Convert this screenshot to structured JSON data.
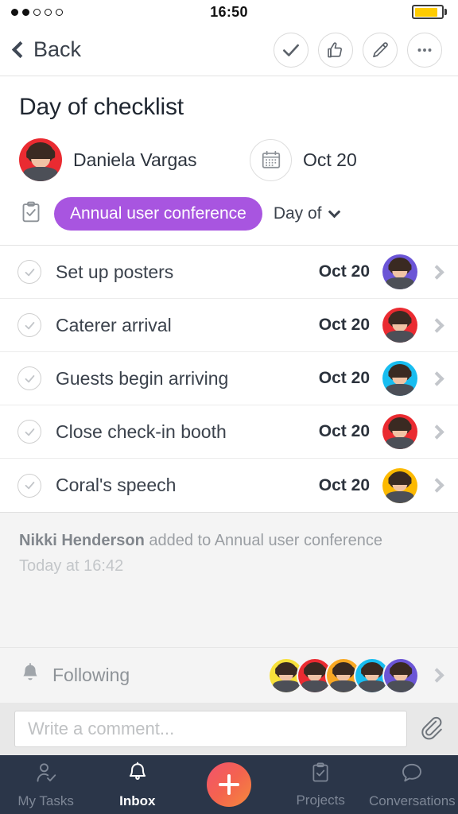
{
  "status_bar": {
    "signal_dots_filled": 2,
    "signal_dots_total": 5,
    "time": "16:50",
    "battery_level_percent": 86,
    "battery_color": "#ffcc00"
  },
  "navbar": {
    "back_label": "Back",
    "actions": [
      {
        "name": "complete-icon",
        "label": "Complete"
      },
      {
        "name": "like-icon",
        "label": "Like"
      },
      {
        "name": "edit-icon",
        "label": "Edit"
      },
      {
        "name": "more-icon",
        "label": "More"
      }
    ]
  },
  "task": {
    "title": "Day of checklist",
    "assignee": "Daniela Vargas",
    "assignee_avatar_color": "#ea2b31",
    "due_date": "Oct 20",
    "project_tag": "Annual user conference",
    "project_tag_color": "#a855e0",
    "section": "Day of"
  },
  "subtasks": [
    {
      "name": "Set up posters",
      "date": "Oct 20",
      "avatar_color": "#6b55d6"
    },
    {
      "name": "Caterer arrival",
      "date": "Oct 20",
      "avatar_color": "#ea2b31"
    },
    {
      "name": "Guests begin arriving",
      "date": "Oct 20",
      "avatar_color": "#18bdf0"
    },
    {
      "name": "Close check-in booth",
      "date": "Oct 20",
      "avatar_color": "#ea2b31"
    },
    {
      "name": "Coral's speech",
      "date": "Oct 20",
      "avatar_color": "#fcb900"
    }
  ],
  "activity": {
    "actor": "Nikki Henderson",
    "text": " added to Annual user conference",
    "timestamp": "Today at 16:42"
  },
  "following": {
    "label": "Following",
    "avatars": [
      "#f7e03a",
      "#ea2b31",
      "#f9a823",
      "#18bdf0",
      "#6b55d6"
    ]
  },
  "comment": {
    "placeholder": "Write a comment...",
    "value": "",
    "attach_icon": "paperclip-icon"
  },
  "tabbar": {
    "items": [
      {
        "label": "My Tasks",
        "icon": "person-check-icon",
        "active": false
      },
      {
        "label": "Inbox",
        "icon": "bell-icon",
        "active": true
      },
      {
        "label": "Projects",
        "icon": "clipboard-icon",
        "active": false
      },
      {
        "label": "Conversations",
        "icon": "speech-bubble-icon",
        "active": false
      }
    ],
    "fab": {
      "icon": "plus-icon",
      "color_start": "#f2536d",
      "color_end": "#f58a3c"
    },
    "background_color": "#2b3649"
  }
}
